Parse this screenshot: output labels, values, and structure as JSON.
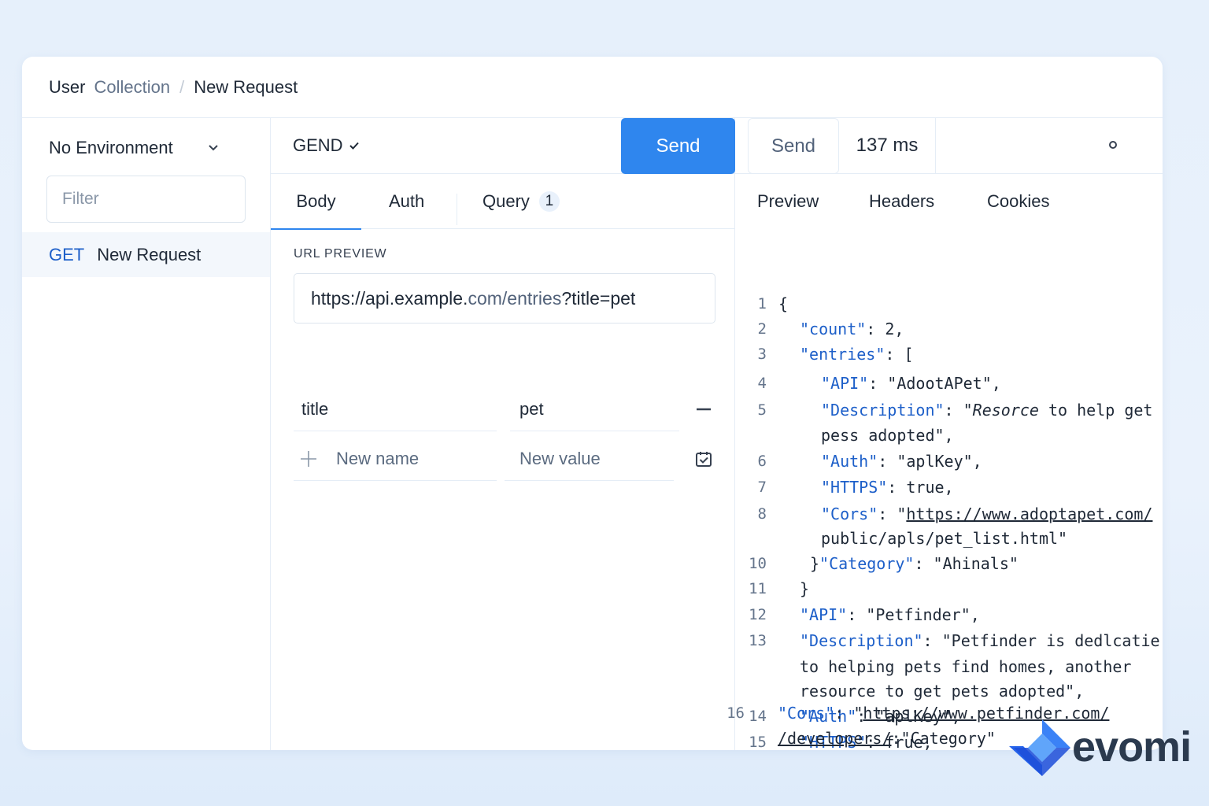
{
  "breadcrumb": {
    "user": "User",
    "collection": "Collection",
    "separator": "/",
    "current": "New Request"
  },
  "sidebar": {
    "environment": "No Environment",
    "filter_placeholder": "Filter",
    "requests": [
      {
        "method": "GET",
        "name": "New Request"
      }
    ]
  },
  "request": {
    "method": "GEND",
    "send_label": "Send",
    "tabs": {
      "body": "Body",
      "auth": "Auth",
      "query": "Query",
      "query_count": "1"
    },
    "url_preview_label": "URL PREVIEW",
    "url": {
      "part1": "https://api.example.",
      "part2": "com/entries",
      "part3": "?title=pet"
    },
    "params": [
      {
        "name": "title",
        "value": "pet"
      }
    ],
    "new_name_placeholder": "New name",
    "new_value_placeholder": "New value"
  },
  "response": {
    "send_label": "Send",
    "time": "137 ms",
    "tabs": {
      "preview": "Preview",
      "headers": "Headers",
      "cookies": "Cookies"
    },
    "lines": {
      "n1": "1",
      "l1": "{",
      "n2": "2",
      "l2_k": "\"count\"",
      "l2_v": ": 2,",
      "n3": "3",
      "l3_k": "\"entries\"",
      "l3_v": ": [",
      "n4": "4",
      "l4_k": "\"API\"",
      "l4_v": ": \"AdootAPet\",",
      "n5": "5",
      "l5_k": "\"Description\"",
      "l5_v1": ": \"",
      "l5_it": "Resorce",
      "l5_v2": " to help get",
      "l5b": "pess adopted\",",
      "n6": "6",
      "l6_k": "\"Auth\"",
      "l6_v": ": \"aplKey\",",
      "n7": "7",
      "l7_k": "\"HTTPS\"",
      "l7_v": ": true,",
      "n8": "8",
      "l8_k": "\"Cors\"",
      "l8_v1": ": \"",
      "l8_u": "https://www.adoptapet.com/",
      "l8b": "public/apls/pet_list.html\"",
      "n10": "10",
      "l10_b": "}",
      "l10_k": "\"Category\"",
      "l10_v": ": \"Ahinals\"",
      "n11": "11",
      "l11": "}",
      "n12": "12",
      "l12_k": "\"API\"",
      "l12_v": ":  \"Petfinder\",",
      "n13": "13",
      "l13_k": "\"Description\"",
      "l13_v": ": \"Petfinder is dedlcatie",
      "l13b": "to helping pets find homes, another",
      "l13c": "resource to get pets adopted\",",
      "n14": "14",
      "l14_k": "\"Auth\"",
      "l14_v": ": \"aplKey\",",
      "n15": "15",
      "l15_k": "\"HTTPS\"",
      "l15_v": ": frue,",
      "n16": "16",
      "l16_k": "\"Cors\"",
      "l16_v1": ": \"",
      "l16_u": "https://www.petfinder.com/",
      "l16b_u": "/developers/",
      "l16b_v": ":\"Category\""
    }
  },
  "logo": {
    "text": "evomi"
  }
}
